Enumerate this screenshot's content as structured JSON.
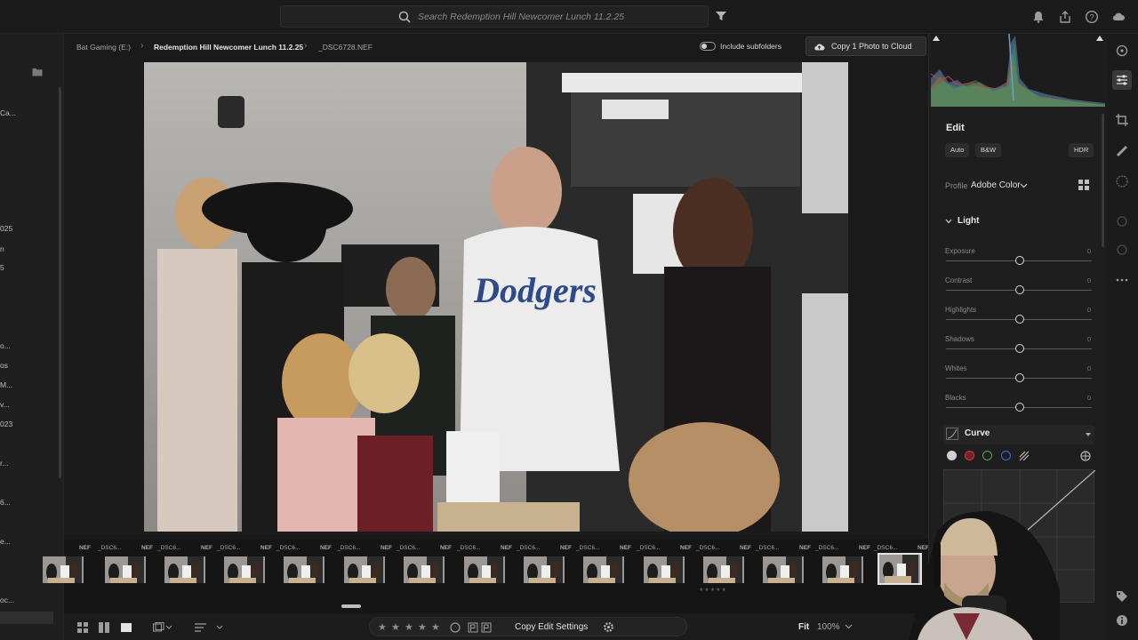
{
  "search": {
    "placeholder": "Search Redemption Hill Newcomer Lunch 11.2.25"
  },
  "breadcrumb": {
    "drive": "Bat Gaming  (E:)",
    "album": "Redemption Hill Newcomer Lunch 11.2.25",
    "file": "_DSC6728.NEF"
  },
  "include_subfolders": {
    "label": "Include subfolders",
    "enabled": false
  },
  "copy_cloud": {
    "label": "Copy 1 Photo to Cloud"
  },
  "left_panel": {
    "fragments": [
      "Ca...",
      "025",
      "n",
      "5",
      "o...",
      "os",
      "M...",
      "v...",
      "023",
      "r...",
      "6...",
      "e...",
      "oc..."
    ]
  },
  "filmstrip": {
    "thumbs": [
      {
        "name": "",
        "ext": "NEF"
      },
      {
        "name": "_DSC6...",
        "ext": "NEF"
      },
      {
        "name": "_DSC6...",
        "ext": "NEF"
      },
      {
        "name": "_DSC6...",
        "ext": "NEF"
      },
      {
        "name": "_DSC6...",
        "ext": "NEF"
      },
      {
        "name": "_DSC6...",
        "ext": "NEF"
      },
      {
        "name": "_DSC6...",
        "ext": "NEF"
      },
      {
        "name": "_DSC6...",
        "ext": "NEF"
      },
      {
        "name": "_DSC6...",
        "ext": "NEF"
      },
      {
        "name": "_DSC6...",
        "ext": "NEF"
      },
      {
        "name": "_DSC6...",
        "ext": "NEF"
      },
      {
        "name": "_DSC6...",
        "ext": "NEF"
      },
      {
        "name": "_DSC6...",
        "ext": "NEF"
      },
      {
        "name": "_DSC6...",
        "ext": "NEF"
      },
      {
        "name": "_DSC6...",
        "ext": "NEF"
      }
    ],
    "selected_index": 14
  },
  "bottom": {
    "copy_edit_label": "Copy Edit Settings",
    "fit_label": "Fit",
    "zoom_label": "100%",
    "rating": 0
  },
  "edit": {
    "title": "Edit",
    "auto_label": "Auto",
    "bw_label": "B&W",
    "hdr_label": "HDR",
    "profile_label": "Profile",
    "profile_value": "Adobe Color",
    "light_label": "Light",
    "curve_label": "Curve",
    "sliders": [
      {
        "label": "Exposure",
        "value": "0"
      },
      {
        "label": "Contrast",
        "value": "0"
      },
      {
        "label": "Highlights",
        "value": "0"
      },
      {
        "label": "Shadows",
        "value": "0"
      },
      {
        "label": "Whites",
        "value": "0"
      },
      {
        "label": "Blacks",
        "value": "0"
      }
    ]
  },
  "colors": {
    "accent": "#e6e6e6",
    "curve_red": "#d23c3c",
    "curve_green": "#3cb34a",
    "curve_blue": "#3c6fd2"
  },
  "icons": {
    "top": [
      "search-icon",
      "filter-icon",
      "bell-icon",
      "share-icon",
      "help-icon",
      "cloud-icon"
    ],
    "tools": [
      "edit-sliders-icon",
      "crop-icon",
      "healing-icon",
      "mask-icon",
      "redeye-icon",
      "presets-icon",
      "more-icon",
      "tag-icon",
      "info-icon"
    ]
  }
}
